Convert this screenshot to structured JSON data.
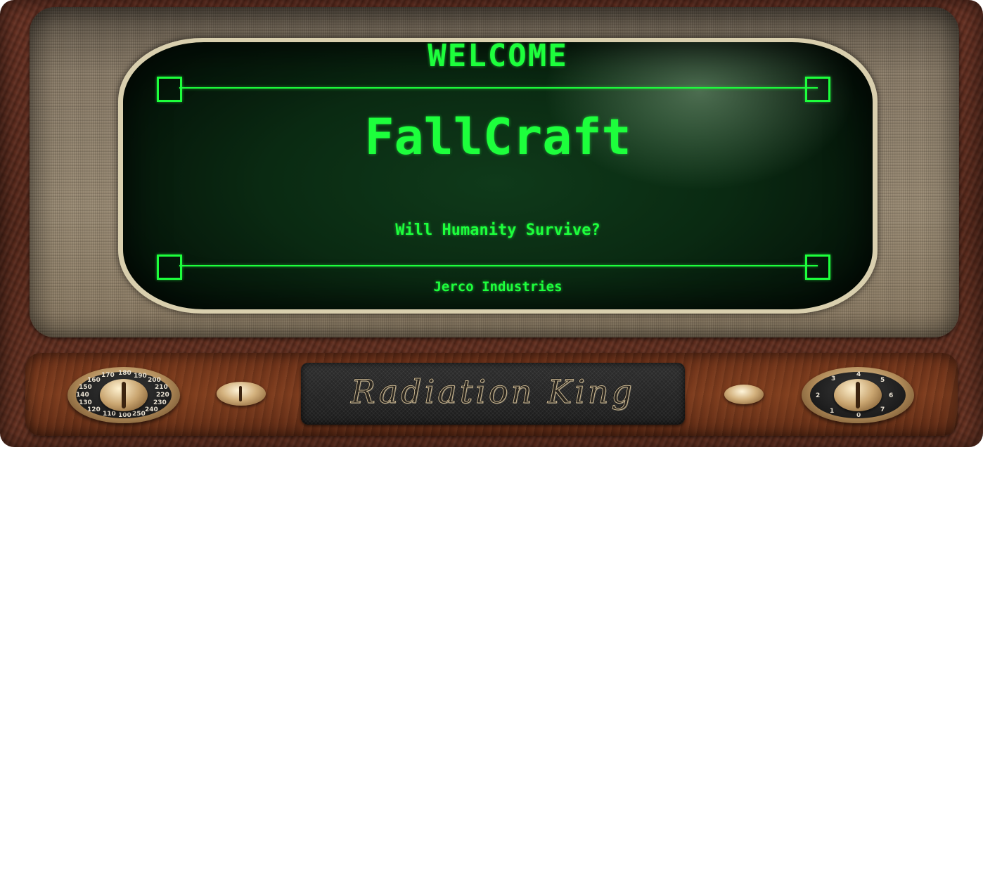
{
  "screen": {
    "welcome": "WELCOME",
    "title": "FallCraft",
    "subtitle": "Will Humanity Survive?",
    "company": "Jerco Industries"
  },
  "tv": {
    "brand": "Radiation King",
    "left_dial_numbers": [
      "180",
      "190",
      "200",
      "210",
      "220",
      "230",
      "240",
      "250",
      "100",
      "110",
      "120",
      "130",
      "140",
      "150",
      "160",
      "170"
    ],
    "right_dial_numbers": [
      "3",
      "4",
      "5",
      "6",
      "7",
      "0",
      "1",
      "2"
    ]
  },
  "colors": {
    "phosphor_green": "#1dff3c",
    "screen_dark": "#0a2a12",
    "wood": "#5a2a1c"
  }
}
